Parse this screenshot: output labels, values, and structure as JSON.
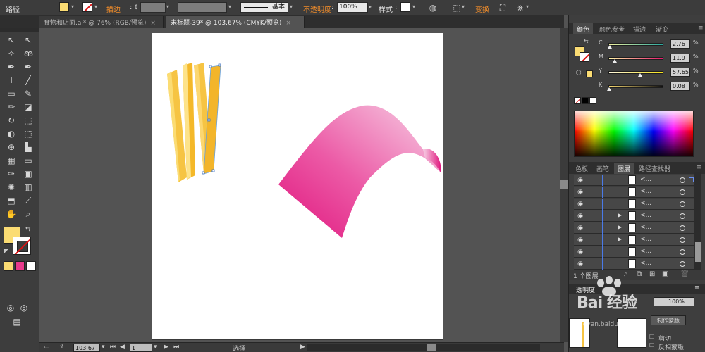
{
  "control_bar": {
    "selection_label": "路径",
    "stroke_label": "描边",
    "stroke_profile_label": "基本",
    "opacity_label": "不透明度",
    "opacity_value": "100%",
    "style_label": "样式",
    "transform_label": "变换",
    "fill_color": "#fbdc73"
  },
  "tabs": [
    {
      "label": "食物和店面.ai* @ 76% (RGB/预览)",
      "close": "×"
    },
    {
      "label": "未标题-39* @ 103.67% (CMYK/预览)",
      "close": "×"
    }
  ],
  "toolbar": {
    "tools": [
      {
        "name": "selection-tool",
        "glyph": "↖"
      },
      {
        "name": "direct-selection-tool",
        "glyph": "↖"
      },
      {
        "name": "magic-wand-tool",
        "glyph": "✧"
      },
      {
        "name": "lasso-tool",
        "glyph": "ഌ"
      },
      {
        "name": "pen-tool",
        "glyph": "✒"
      },
      {
        "name": "curvature-tool",
        "glyph": "✒"
      },
      {
        "name": "type-tool",
        "glyph": "T"
      },
      {
        "name": "line-tool",
        "glyph": "╱"
      },
      {
        "name": "rectangle-tool",
        "glyph": "▭"
      },
      {
        "name": "paintbrush-tool",
        "glyph": "✎"
      },
      {
        "name": "pencil-tool",
        "glyph": "✏"
      },
      {
        "name": "eraser-tool",
        "glyph": "◪"
      },
      {
        "name": "rotate-tool",
        "glyph": "↻"
      },
      {
        "name": "scale-tool",
        "glyph": "⬚"
      },
      {
        "name": "width-tool",
        "glyph": "◐"
      },
      {
        "name": "free-transform-tool",
        "glyph": "⬚"
      },
      {
        "name": "shape-builder-tool",
        "glyph": "⊕"
      },
      {
        "name": "perspective-grid-tool",
        "glyph": "▙"
      },
      {
        "name": "mesh-tool",
        "glyph": "▦"
      },
      {
        "name": "gradient-tool",
        "glyph": "▭"
      },
      {
        "name": "eyedropper-tool",
        "glyph": "✑"
      },
      {
        "name": "blend-tool",
        "glyph": "▣"
      },
      {
        "name": "symbol-sprayer-tool",
        "glyph": "✺"
      },
      {
        "name": "column-graph-tool",
        "glyph": "▥"
      },
      {
        "name": "artboard-tool",
        "glyph": "⬒"
      },
      {
        "name": "slice-tool",
        "glyph": "⟋"
      },
      {
        "name": "hand-tool",
        "glyph": "✋"
      },
      {
        "name": "zoom-tool",
        "glyph": "⌕"
      }
    ],
    "fill_color": "#fbdc73",
    "mini_swatches": [
      "#fbdc73",
      "#e83a8c",
      "#ffffff"
    ]
  },
  "artboard": {
    "ribbon_gradient": [
      "#e0157d",
      "#ec5aa6",
      "#f7d2e6"
    ],
    "stick_color": "#f6c443"
  },
  "status": {
    "zoom_value": "103.67",
    "page_value": "1",
    "mode_label": "选择"
  },
  "color_panel": {
    "tabs": [
      "颜色",
      "颜色参考",
      "描边",
      "渐变"
    ],
    "sliders": [
      {
        "label": "C",
        "value": "2.76",
        "pos": 0.03,
        "gradient": [
          "#f2f2a0",
          "#2aa8a0"
        ]
      },
      {
        "label": "M",
        "value": "11.9",
        "pos": 0.12,
        "gradient": [
          "#fff7a8",
          "#e5196c"
        ]
      },
      {
        "label": "Y",
        "value": "57.65",
        "pos": 0.58,
        "gradient": [
          "#fff8e0",
          "#f5e21a"
        ]
      },
      {
        "label": "K",
        "value": "0.08",
        "pos": 0.01,
        "gradient": [
          "#f7d872",
          "#111111"
        ]
      }
    ],
    "percent": "%"
  },
  "layers_panel": {
    "tabs": [
      "色板",
      "画笔",
      "图层",
      "路径查找器"
    ],
    "rows": [
      {
        "name": "<...",
        "arrow": ""
      },
      {
        "name": "<...",
        "arrow": ""
      },
      {
        "name": "<...",
        "arrow": ""
      },
      {
        "name": "<...",
        "arrow": "▶"
      },
      {
        "name": "<...",
        "arrow": "▶"
      },
      {
        "name": "<...",
        "arrow": "▶"
      },
      {
        "name": "<...",
        "arrow": ""
      },
      {
        "name": "<...",
        "arrow": ""
      }
    ],
    "footer_count": "1 个图层"
  },
  "transparency_panel": {
    "title": "透明度",
    "opacity_value": "100%",
    "make_mask_label": "制作蒙版",
    "clip_label": "剪切",
    "invert_label": "反相蒙版"
  },
  "watermark": {
    "text": "Bai 经验",
    "url": "jingyan.baidu.com"
  }
}
